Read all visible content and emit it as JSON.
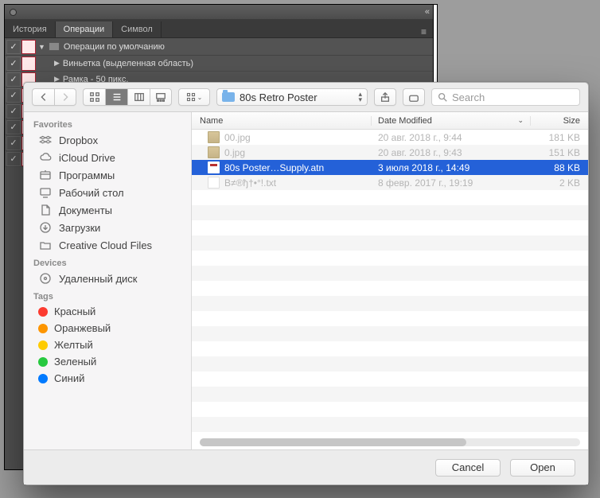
{
  "ps_panel": {
    "tabs": {
      "history": "История",
      "actions": "Операции",
      "symbol": "Символ"
    },
    "group_label": "Операции по умолчанию",
    "actions": [
      {
        "label": "Виньетка (выделенная область)"
      },
      {
        "label": "Рамка - 50 пикс."
      }
    ]
  },
  "dialog": {
    "toolbar": {
      "path_label": "80s Retro Poster",
      "search_placeholder": "Search"
    },
    "sidebar": {
      "favorites_header": "Favorites",
      "favorites": [
        {
          "key": "dropbox",
          "label": "Dropbox",
          "icon": "dropbox"
        },
        {
          "key": "icloud",
          "label": "iCloud Drive",
          "icon": "cloud"
        },
        {
          "key": "apps",
          "label": "Программы",
          "icon": "apps"
        },
        {
          "key": "desktop",
          "label": "Рабочий стол",
          "icon": "desktop"
        },
        {
          "key": "documents",
          "label": "Документы",
          "icon": "doc"
        },
        {
          "key": "downloads",
          "label": "Загрузки",
          "icon": "downloads"
        },
        {
          "key": "ccf",
          "label": "Creative Cloud Files",
          "icon": "folder"
        }
      ],
      "devices_header": "Devices",
      "devices": [
        {
          "key": "remote",
          "label": "Удаленный диск",
          "icon": "disc"
        }
      ],
      "tags_header": "Tags",
      "tags": [
        {
          "label": "Красный",
          "color": "#fc3b30"
        },
        {
          "label": "Оранжевый",
          "color": "#fd9500"
        },
        {
          "label": "Желтый",
          "color": "#fecb00"
        },
        {
          "label": "Зеленый",
          "color": "#27c93f"
        },
        {
          "label": "Синий",
          "color": "#007aff"
        }
      ]
    },
    "columns": {
      "name": "Name",
      "date": "Date Modified",
      "size": "Size"
    },
    "files": [
      {
        "name": "00.jpg",
        "date": "20 авг. 2018 г., 9:44",
        "size": "181 KB",
        "icon": "img",
        "dim": true,
        "selected": false
      },
      {
        "name": "0.jpg",
        "date": "20 авг. 2018 г., 9:43",
        "size": "151 KB",
        "icon": "img",
        "dim": true,
        "selected": false
      },
      {
        "name": "80s Poster…Supply.atn",
        "date": "3 июля 2018 г., 14:49",
        "size": "88 KB",
        "icon": "atn",
        "dim": false,
        "selected": true
      },
      {
        "name": "В≠®ђ†•°!.txt",
        "date": "8 февр. 2017 г., 19:19",
        "size": "2 KB",
        "icon": "txt",
        "dim": true,
        "selected": false
      }
    ],
    "footer": {
      "cancel": "Cancel",
      "open": "Open"
    }
  }
}
